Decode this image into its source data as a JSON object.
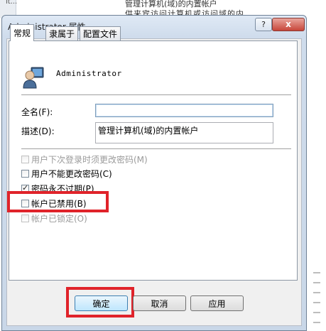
{
  "background": {
    "left_text": "it...",
    "desc_line1": "管理计算机(域)的内置帐户",
    "desc_line2": "供来宾访问计算机或访问域的内"
  },
  "dialog": {
    "title": "Administrator 属性",
    "help_label": "?",
    "close_label": "x"
  },
  "tabs": [
    {
      "label": "常规"
    },
    {
      "label": "隶属于"
    },
    {
      "label": "配置文件"
    }
  ],
  "user": {
    "icon": "user-icon",
    "name": "Administrator"
  },
  "fields": {
    "fullname_label": "全名(F):",
    "fullname_value": "",
    "description_label": "描述(D):",
    "description_value": "管理计算机(域)的内置帐户"
  },
  "options": [
    {
      "label": "用户下次登录时须更改密码(M)",
      "checked": false,
      "enabled": false
    },
    {
      "label": "用户不能更改密码(C)",
      "checked": false,
      "enabled": true
    },
    {
      "label": "密码永不过期(P)",
      "checked": true,
      "enabled": true
    },
    {
      "label": "帐户已禁用(B)",
      "checked": false,
      "enabled": true
    },
    {
      "label": "帐户已锁定(O)",
      "checked": false,
      "enabled": false
    }
  ],
  "buttons": {
    "ok": "确定",
    "cancel": "取消",
    "apply": "应用"
  },
  "colors": {
    "highlight": "#e0232a"
  }
}
